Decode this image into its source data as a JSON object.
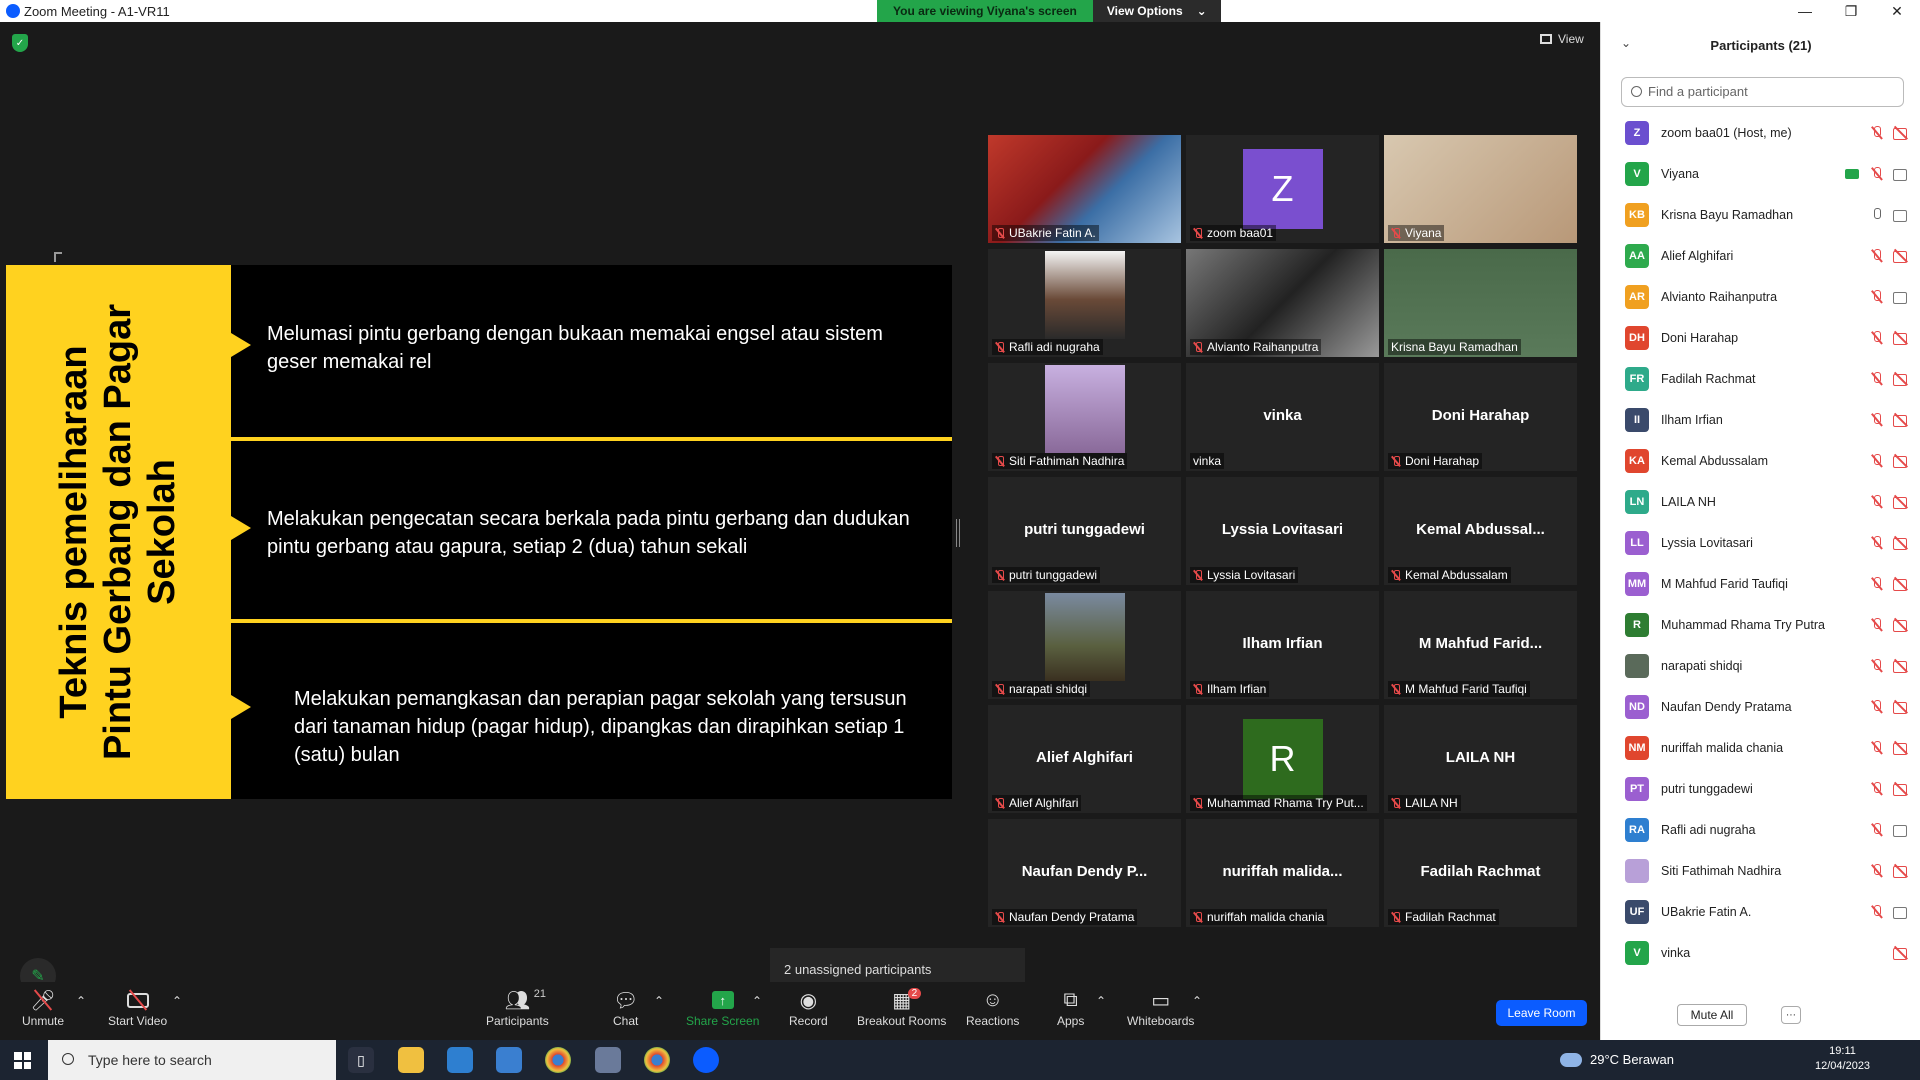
{
  "window": {
    "title": "Zoom Meeting - A1-VR11",
    "banner_viewing": "You are viewing Viyana's screen",
    "banner_view_options": "View Options"
  },
  "meeting": {
    "view_label": "View",
    "unassigned": "2 unassigned participants"
  },
  "slide": {
    "title_line1": "Teknis pemeliharaan",
    "title_line2": "Pintu Gerbang dan Pagar",
    "title_line3": "Sekolah",
    "items": [
      "Melumasi pintu gerbang dengan bukaan memakai engsel atau sistem geser memakai rel",
      "Melakukan pengecatan secara berkala pada pintu gerbang dan dudukan pintu gerbang atau gapura, setiap 2 (dua) tahun sekali",
      "Melakukan pemangkasan dan perapian pagar sekolah yang tersusun dari tanaman hidup (pagar hidup), dipangkas dan dirapihkan setiap 1 (satu) bulan"
    ]
  },
  "gallery": [
    {
      "label": "UBakrie Fatin A.",
      "big": "",
      "kind": "video"
    },
    {
      "label": "zoom baa01",
      "big": "Z",
      "kind": "avatar"
    },
    {
      "label": "Viyana",
      "big": "",
      "kind": "video"
    },
    {
      "label": "Rafli adi nugraha",
      "big": "",
      "kind": "photo"
    },
    {
      "label": "Alvianto Raihanputra",
      "big": "",
      "kind": "video"
    },
    {
      "label": "Krisna Bayu Ramadhan",
      "big": "",
      "kind": "video"
    },
    {
      "label": "Siti Fathimah Nadhira",
      "big": "",
      "kind": "photo"
    },
    {
      "label": "vinka",
      "big": "vinka",
      "kind": "name"
    },
    {
      "label": "Doni Harahap",
      "big": "Doni Harahap",
      "kind": "name"
    },
    {
      "label": "putri tunggadewi",
      "big": "putri tunggadewi",
      "kind": "name"
    },
    {
      "label": "Lyssia Lovitasari",
      "big": "Lyssia Lovitasari",
      "kind": "name"
    },
    {
      "label": "Kemal Abdussalam",
      "big": "Kemal Abdussal...",
      "kind": "name"
    },
    {
      "label": "narapati shidqi",
      "big": "",
      "kind": "photo"
    },
    {
      "label": "Ilham Irfian",
      "big": "Ilham Irfian",
      "kind": "name"
    },
    {
      "label": "M Mahfud Farid Taufiqi",
      "big": "M Mahfud Farid...",
      "kind": "name"
    },
    {
      "label": "Alief Alghifari",
      "big": "Alief Alghifari",
      "kind": "name"
    },
    {
      "label": "Muhammad Rhama Try Put...",
      "big": "R",
      "kind": "avatar"
    },
    {
      "label": "LAILA NH",
      "big": "LAILA NH",
      "kind": "name"
    },
    {
      "label": "Naufan Dendy Pratama",
      "big": "Naufan Dendy P...",
      "kind": "name"
    },
    {
      "label": "nuriffah malida chania",
      "big": "nuriffah malida...",
      "kind": "name"
    },
    {
      "label": "Fadilah Rachmat",
      "big": "Fadilah Rachmat",
      "kind": "name"
    }
  ],
  "toolbar": {
    "unmute": "Unmute",
    "start_video": "Start Video",
    "participants": "Participants",
    "participants_count": "21",
    "chat": "Chat",
    "share_screen": "Share Screen",
    "record": "Record",
    "breakout_rooms": "Breakout Rooms",
    "breakout_badge": "2",
    "reactions": "Reactions",
    "apps": "Apps",
    "whiteboards": "Whiteboards",
    "leave_room": "Leave Room"
  },
  "panel": {
    "title": "Participants (21)",
    "find_placeholder": "Find a participant",
    "mute_all": "Mute All",
    "participants": [
      {
        "initials": "Z",
        "name": "zoom baa01 (Host, me)",
        "color": "#6b4fcf",
        "mic": "off",
        "cam": "off"
      },
      {
        "initials": "V",
        "name": "Viyana",
        "color": "#23a54a",
        "mic": "off",
        "cam": "on",
        "sharing": true
      },
      {
        "initials": "KB",
        "name": "Krisna Bayu Ramadhan",
        "color": "#f0a020",
        "mic": "on",
        "cam": "on"
      },
      {
        "initials": "AA",
        "name": "Alief Alghifari",
        "color": "#2eaa4d",
        "mic": "off",
        "cam": "off"
      },
      {
        "initials": "AR",
        "name": "Alvianto Raihanputra",
        "color": "#f0a020",
        "mic": "off",
        "cam": "on"
      },
      {
        "initials": "DH",
        "name": "Doni Harahap",
        "color": "#e0462e",
        "mic": "off",
        "cam": "off"
      },
      {
        "initials": "FR",
        "name": "Fadilah Rachmat",
        "color": "#2eaa8a",
        "mic": "off",
        "cam": "off"
      },
      {
        "initials": "II",
        "name": "Ilham Irfian",
        "color": "#3a4a6b",
        "mic": "off",
        "cam": "off"
      },
      {
        "initials": "KA",
        "name": "Kemal Abdussalam",
        "color": "#e0462e",
        "mic": "off",
        "cam": "off"
      },
      {
        "initials": "LN",
        "name": "LAILA NH",
        "color": "#2eaa8a",
        "mic": "off",
        "cam": "off"
      },
      {
        "initials": "LL",
        "name": "Lyssia Lovitasari",
        "color": "#9b5fd0",
        "mic": "off",
        "cam": "off"
      },
      {
        "initials": "MM",
        "name": "M Mahfud Farid Taufiqi",
        "color": "#9b5fd0",
        "mic": "off",
        "cam": "off"
      },
      {
        "initials": "R",
        "name": "Muhammad Rhama Try Putra",
        "color": "#2e7d32",
        "mic": "off",
        "cam": "off"
      },
      {
        "initials": "",
        "name": "narapati shidqi",
        "color": "#5a6a5a",
        "mic": "off",
        "cam": "off"
      },
      {
        "initials": "ND",
        "name": "Naufan Dendy Pratama",
        "color": "#9b5fd0",
        "mic": "off",
        "cam": "off"
      },
      {
        "initials": "NM",
        "name": "nuriffah malida chania",
        "color": "#e0462e",
        "mic": "off",
        "cam": "off"
      },
      {
        "initials": "PT",
        "name": "putri tunggadewi",
        "color": "#9b5fd0",
        "mic": "off",
        "cam": "off"
      },
      {
        "initials": "RA",
        "name": "Rafli adi nugraha",
        "color": "#2e7fd0",
        "mic": "off",
        "cam": "on"
      },
      {
        "initials": "",
        "name": "Siti Fathimah Nadhira",
        "color": "#b8a0d8",
        "mic": "off",
        "cam": "off"
      },
      {
        "initials": "UF",
        "name": "UBakrie Fatin A.",
        "color": "#3a4a6b",
        "mic": "off",
        "cam": "on"
      },
      {
        "initials": "V",
        "name": "vinka",
        "color": "#23a54a",
        "mic": "",
        "cam": "off"
      }
    ]
  },
  "taskbar": {
    "search_placeholder": "Type here to search",
    "weather": "29°C  Berawan",
    "time": "19:11",
    "date": "12/04/2023"
  }
}
